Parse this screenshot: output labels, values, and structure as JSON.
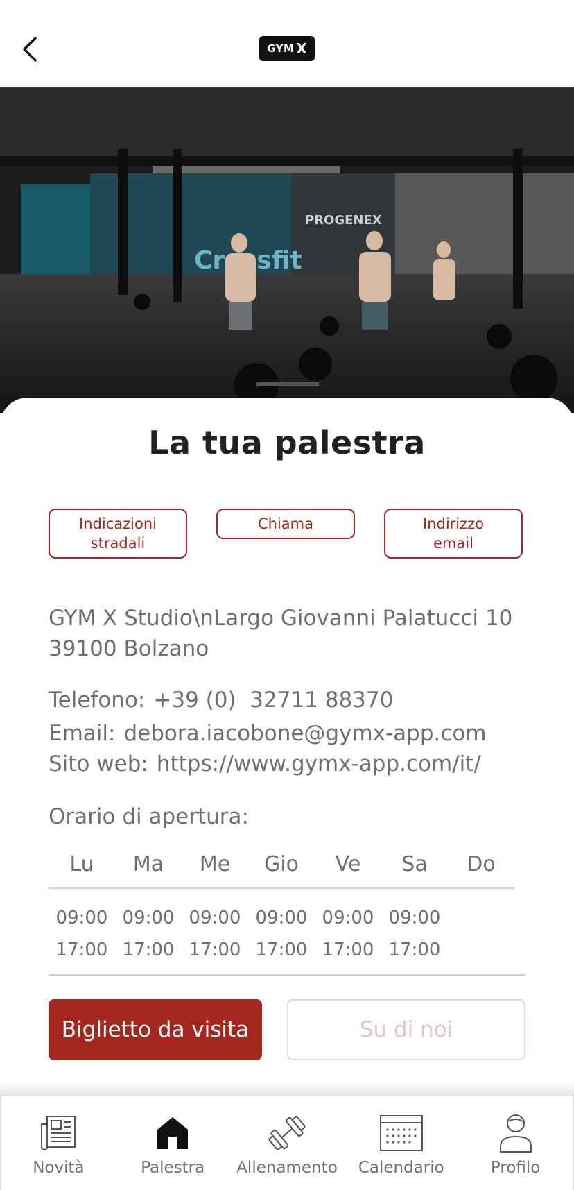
{
  "header": {
    "back_icon": "chevron-left-icon",
    "logo_text": "GYM",
    "logo_mark": "X"
  },
  "hero": {
    "image": "gym-interior-photo"
  },
  "card": {
    "title": "La tua palestra",
    "actions": {
      "directions_line1": "Indicazioni",
      "directions_line2": "stradali",
      "call": "Chiama",
      "email_line1": "Indirizzo",
      "email_line2": "email"
    },
    "address": {
      "line1": "GYM X Studio\\nLargo Giovanni Palatucci 10",
      "line2": "39100 Bolzano"
    },
    "contacts": {
      "phone_label": "Telefono:",
      "phone_value": "+39 (0)  32711 88370",
      "email_label": "Email:",
      "email_value": "debora.iacobone@gymx-app.com",
      "web_label": "Sito web:",
      "web_value": "https://www.gymx-app.com/it/"
    },
    "hours": {
      "label": "Orario di apertura:",
      "days": [
        "Lu",
        "Ma",
        "Me",
        "Gio",
        "Ve",
        "Sa",
        "Do"
      ],
      "open": [
        "09:00",
        "09:00",
        "09:00",
        "09:00",
        "09:00",
        "09:00",
        ""
      ],
      "close": [
        "17:00",
        "17:00",
        "17:00",
        "17:00",
        "17:00",
        "17:00",
        ""
      ]
    },
    "buttons": {
      "business_card": "Biglietto da visita",
      "about_us": "Su di noi"
    }
  },
  "tabbar": {
    "items": [
      {
        "label": "Novità",
        "icon": "newspaper-icon"
      },
      {
        "label": "Palestra",
        "icon": "home-icon"
      },
      {
        "label": "Allenamento",
        "icon": "dumbbell-icon"
      },
      {
        "label": "Calendario",
        "icon": "calendar-icon"
      },
      {
        "label": "Profilo",
        "icon": "user-icon"
      }
    ],
    "active": "Palestra"
  },
  "colors": {
    "accent": "#a3261f",
    "accent_disabled": "#e9c3c0",
    "text": "#6f6f6f",
    "title": "#222222"
  }
}
